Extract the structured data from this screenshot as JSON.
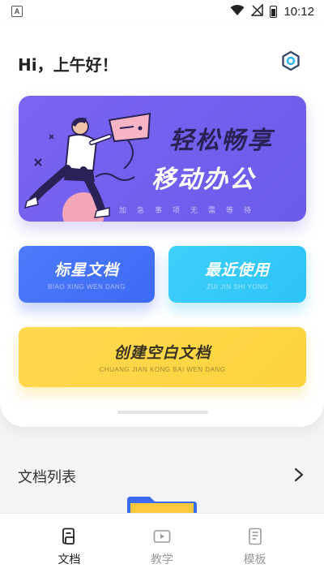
{
  "status_bar": {
    "notification_icon_letter": "A",
    "time": "10:12",
    "icons": [
      "wifi-icon",
      "no-signal-icon",
      "battery-charging-icon"
    ]
  },
  "header": {
    "greeting": "Hi，上午好！",
    "settings_icon": "settings-hexagon-icon"
  },
  "banner": {
    "title_line1": "轻松畅享",
    "title_line2": "移动办公",
    "subtitle": "加急事项无需等待",
    "colors": {
      "background": "#7b64f2",
      "title1": "#2a2256",
      "title2": "#ffffff"
    }
  },
  "tiles": {
    "starred": {
      "title": "标星文档",
      "subtitle": "BIAO XING WEN DANG",
      "color": "#4d7bfb"
    },
    "recent": {
      "title": "最近使用",
      "subtitle": "ZUI JIN SHI YONG",
      "color": "#3fd0fb"
    },
    "create": {
      "title": "创建空白文档",
      "subtitle": "CHUANG JIAN KONG BAI WEN DANG",
      "color": "#ffd84e"
    }
  },
  "document_list": {
    "title": "文档列表",
    "chevron_icon": "chevron-right-icon"
  },
  "bottom_nav": {
    "items": [
      {
        "label": "文档",
        "icon": "document-icon",
        "active": true
      },
      {
        "label": "教学",
        "icon": "video-play-icon",
        "active": false
      },
      {
        "label": "模板",
        "icon": "template-icon",
        "active": false
      }
    ]
  }
}
